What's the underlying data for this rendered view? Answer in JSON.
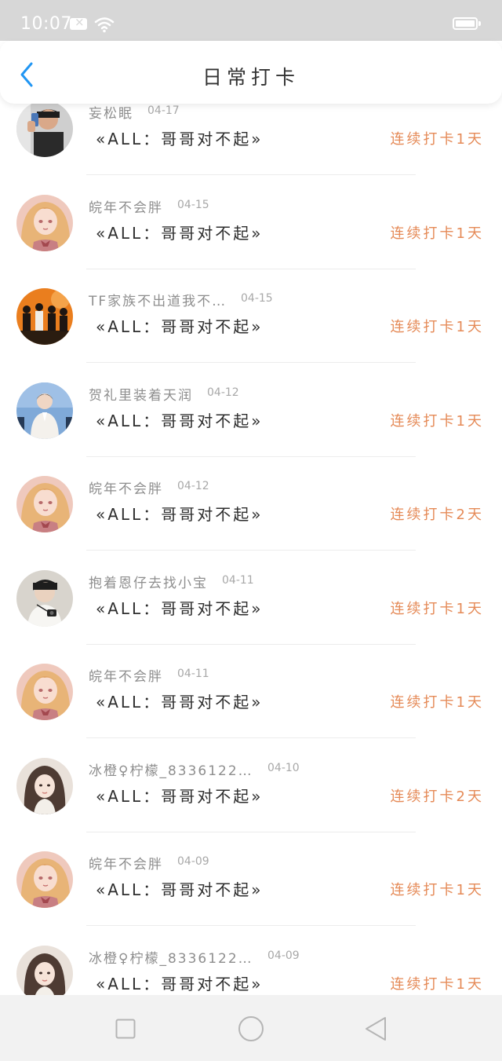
{
  "status_bar": {
    "time": "10:07",
    "icons": [
      "message-icon",
      "wifi-icon",
      "battery-icon"
    ]
  },
  "header": {
    "title": "日常打卡",
    "back_icon": "chevron-left-icon",
    "accent_color": "#2196f3"
  },
  "items": [
    {
      "username": "妄松眠",
      "date": "04-17",
      "content": "«ALL：哥哥对不起»",
      "streak": "连续打卡1天",
      "avatar": "avatar-boy-selfie"
    },
    {
      "username": "皖年不会胖",
      "date": "04-15",
      "content": "«ALL：哥哥对不起»",
      "streak": "连续打卡1天",
      "avatar": "avatar-anime-girl"
    },
    {
      "username": "TF家族不出道我不…",
      "date": "04-15",
      "content": "«ALL：哥哥对不起»",
      "streak": "连续打卡1天",
      "avatar": "avatar-dance-group"
    },
    {
      "username": "贺礼里装着天润",
      "date": "04-12",
      "content": "«ALL：哥哥对不起»",
      "streak": "连续打卡1天",
      "avatar": "avatar-boy-white-suit"
    },
    {
      "username": "皖年不会胖",
      "date": "04-12",
      "content": "«ALL：哥哥对不起»",
      "streak": "连续打卡2天",
      "avatar": "avatar-anime-girl"
    },
    {
      "username": "抱着恩仔去找小宝",
      "date": "04-11",
      "content": "«ALL：哥哥对不起»",
      "streak": "连续打卡1天",
      "avatar": "avatar-boy-camera"
    },
    {
      "username": "皖年不会胖",
      "date": "04-11",
      "content": "«ALL：哥哥对不起»",
      "streak": "连续打卡1天",
      "avatar": "avatar-anime-girl"
    },
    {
      "username": "冰橙♀柠檬_8336122…",
      "date": "04-10",
      "content": "«ALL：哥哥对不起»",
      "streak": "连续打卡2天",
      "avatar": "avatar-girl-portrait"
    },
    {
      "username": "皖年不会胖",
      "date": "04-09",
      "content": "«ALL：哥哥对不起»",
      "streak": "连续打卡1天",
      "avatar": "avatar-anime-girl"
    },
    {
      "username": "冰橙♀柠檬_8336122…",
      "date": "04-09",
      "content": "«ALL：哥哥对不起»",
      "streak": "连续打卡1天",
      "avatar": "avatar-girl-portrait"
    }
  ],
  "nav_bar": {
    "buttons": [
      "recent-apps-icon",
      "home-icon",
      "back-icon"
    ]
  },
  "colors": {
    "streak": "#e58a57",
    "username": "#8e8e8e",
    "content": "#2e2e2e",
    "status_bar_bg": "#d7d7d7",
    "nav_bar_bg": "#f2f2f2"
  }
}
